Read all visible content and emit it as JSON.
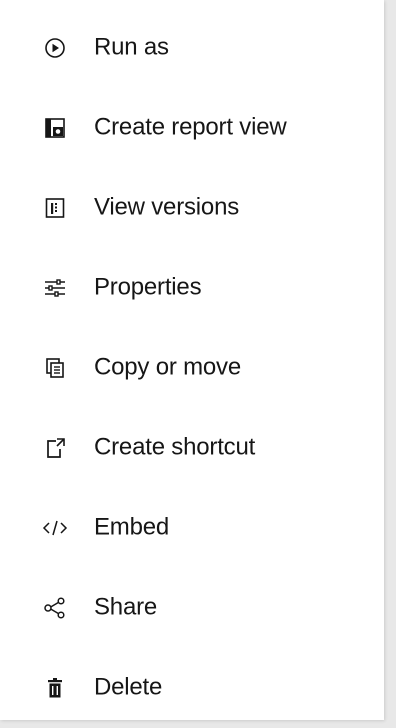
{
  "menu": {
    "items": [
      {
        "label": "Run as",
        "icon": "run-icon"
      },
      {
        "label": "Create report view",
        "icon": "report-view-icon"
      },
      {
        "label": "View versions",
        "icon": "versions-icon"
      },
      {
        "label": "Properties",
        "icon": "properties-sliders-icon"
      },
      {
        "label": "Copy or move",
        "icon": "copy-icon"
      },
      {
        "label": "Create shortcut",
        "icon": "shortcut-icon"
      },
      {
        "label": "Embed",
        "icon": "embed-code-icon"
      },
      {
        "label": "Share",
        "icon": "share-icon"
      },
      {
        "label": "Delete",
        "icon": "trash-icon"
      }
    ]
  },
  "colors": {
    "text": "#161616",
    "background": "#ffffff",
    "backdrop": "#e8e8e8"
  }
}
